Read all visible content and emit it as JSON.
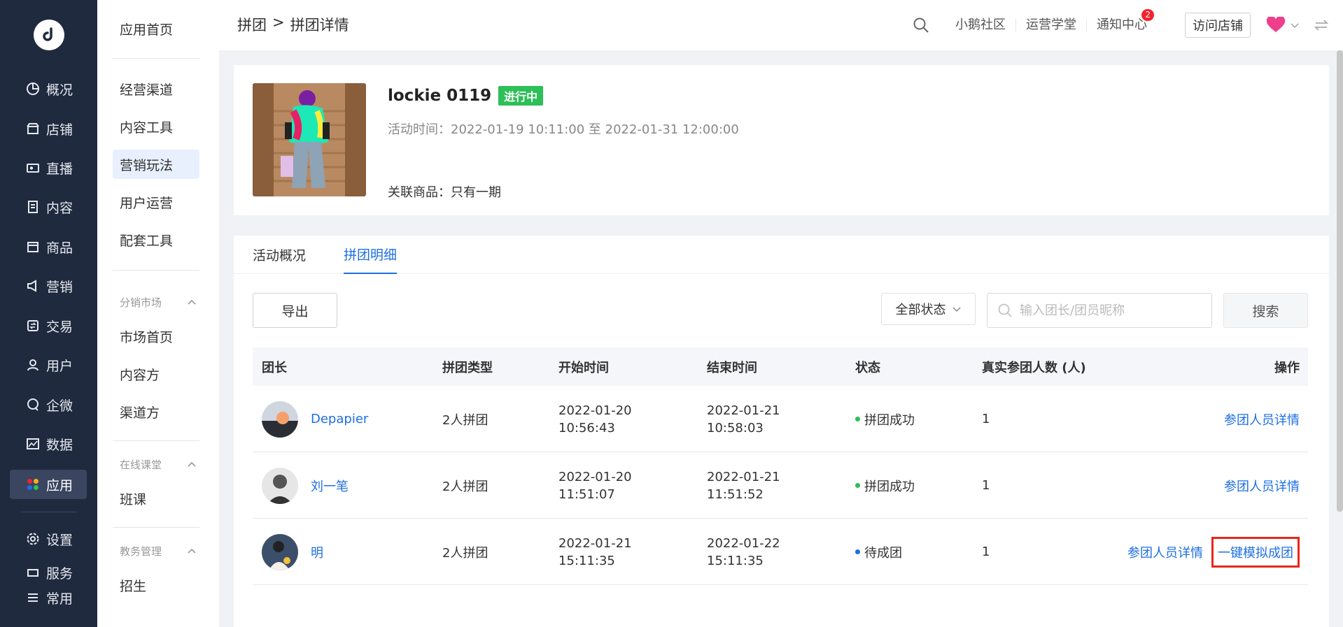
{
  "sidebar": {
    "items": [
      {
        "label": "概况",
        "icon": "pie-chart-icon"
      },
      {
        "label": "店铺",
        "icon": "store-icon"
      },
      {
        "label": "直播",
        "icon": "live-camera-icon"
      },
      {
        "label": "内容",
        "icon": "document-icon"
      },
      {
        "label": "商品",
        "icon": "bag-icon"
      },
      {
        "label": "营销",
        "icon": "megaphone-icon"
      },
      {
        "label": "交易",
        "icon": "transaction-icon"
      },
      {
        "label": "用户",
        "icon": "user-icon"
      },
      {
        "label": "企微",
        "icon": "chat-icon"
      },
      {
        "label": "数据",
        "icon": "chart-image-icon"
      },
      {
        "label": "应用",
        "icon": "apps-grid-icon"
      },
      {
        "label": "设置",
        "icon": "gear-icon"
      },
      {
        "label": "服务",
        "icon": "service-icon"
      },
      {
        "label": "常用",
        "icon": "list-icon"
      }
    ]
  },
  "submenu": {
    "top": "应用首页",
    "items": [
      "经营渠道",
      "内容工具",
      "营销玩法",
      "用户运营",
      "配套工具"
    ],
    "group1": {
      "title": "分销市场",
      "items": [
        "市场首页",
        "内容方",
        "渠道方"
      ]
    },
    "group2": {
      "title": "在线课堂",
      "items": [
        "班课"
      ]
    },
    "group3": {
      "title": "教务管理",
      "items": [
        "招生"
      ]
    }
  },
  "header": {
    "breadcrumb": [
      "拼团",
      ">",
      "拼团详情"
    ],
    "links": [
      "小鹅社区",
      "运营学堂",
      "通知中心"
    ],
    "notice_count": "2",
    "visit_store": "访问店铺"
  },
  "product": {
    "name": "lockie 0119",
    "status": "进行中",
    "time": "活动时间：2022-01-19 10:11:00 至 2022-01-31 12:00:00",
    "linked": "关联商品：只有一期"
  },
  "tabs": [
    "活动概况",
    "拼团明细"
  ],
  "toolbar": {
    "export": "导出",
    "status_filter": "全部状态",
    "search_placeholder": "输入团长/团员昵称",
    "search_button": "搜索"
  },
  "table": {
    "headers": [
      "团长",
      "拼团类型",
      "开始时间",
      "结束时间",
      "状态",
      "真实参团人数 (人)",
      "操作"
    ],
    "rows": [
      {
        "leader": "Depapier",
        "type": "2人拼团",
        "start_date": "2022-01-20",
        "start_time": "10:56:43",
        "end_date": "2022-01-21",
        "end_time": "10:58:03",
        "status": "拼团成功",
        "status_color": "#2dbf58",
        "count": "1",
        "ops": [
          "参团人员详情"
        ]
      },
      {
        "leader": "刘一笔",
        "type": "2人拼团",
        "start_date": "2022-01-20",
        "start_time": "11:51:07",
        "end_date": "2022-01-21",
        "end_time": "11:51:52",
        "status": "拼团成功",
        "status_color": "#2dbf58",
        "count": "1",
        "ops": [
          "参团人员详情"
        ]
      },
      {
        "leader": "明",
        "type": "2人拼团",
        "start_date": "2022-01-21",
        "start_time": "15:11:35",
        "end_date": "2022-01-22",
        "end_time": "15:11:35",
        "status": "待成团",
        "status_color": "#1d6fe3",
        "count": "1",
        "ops": [
          "参团人员详情",
          "一键模拟成团"
        ]
      }
    ]
  }
}
